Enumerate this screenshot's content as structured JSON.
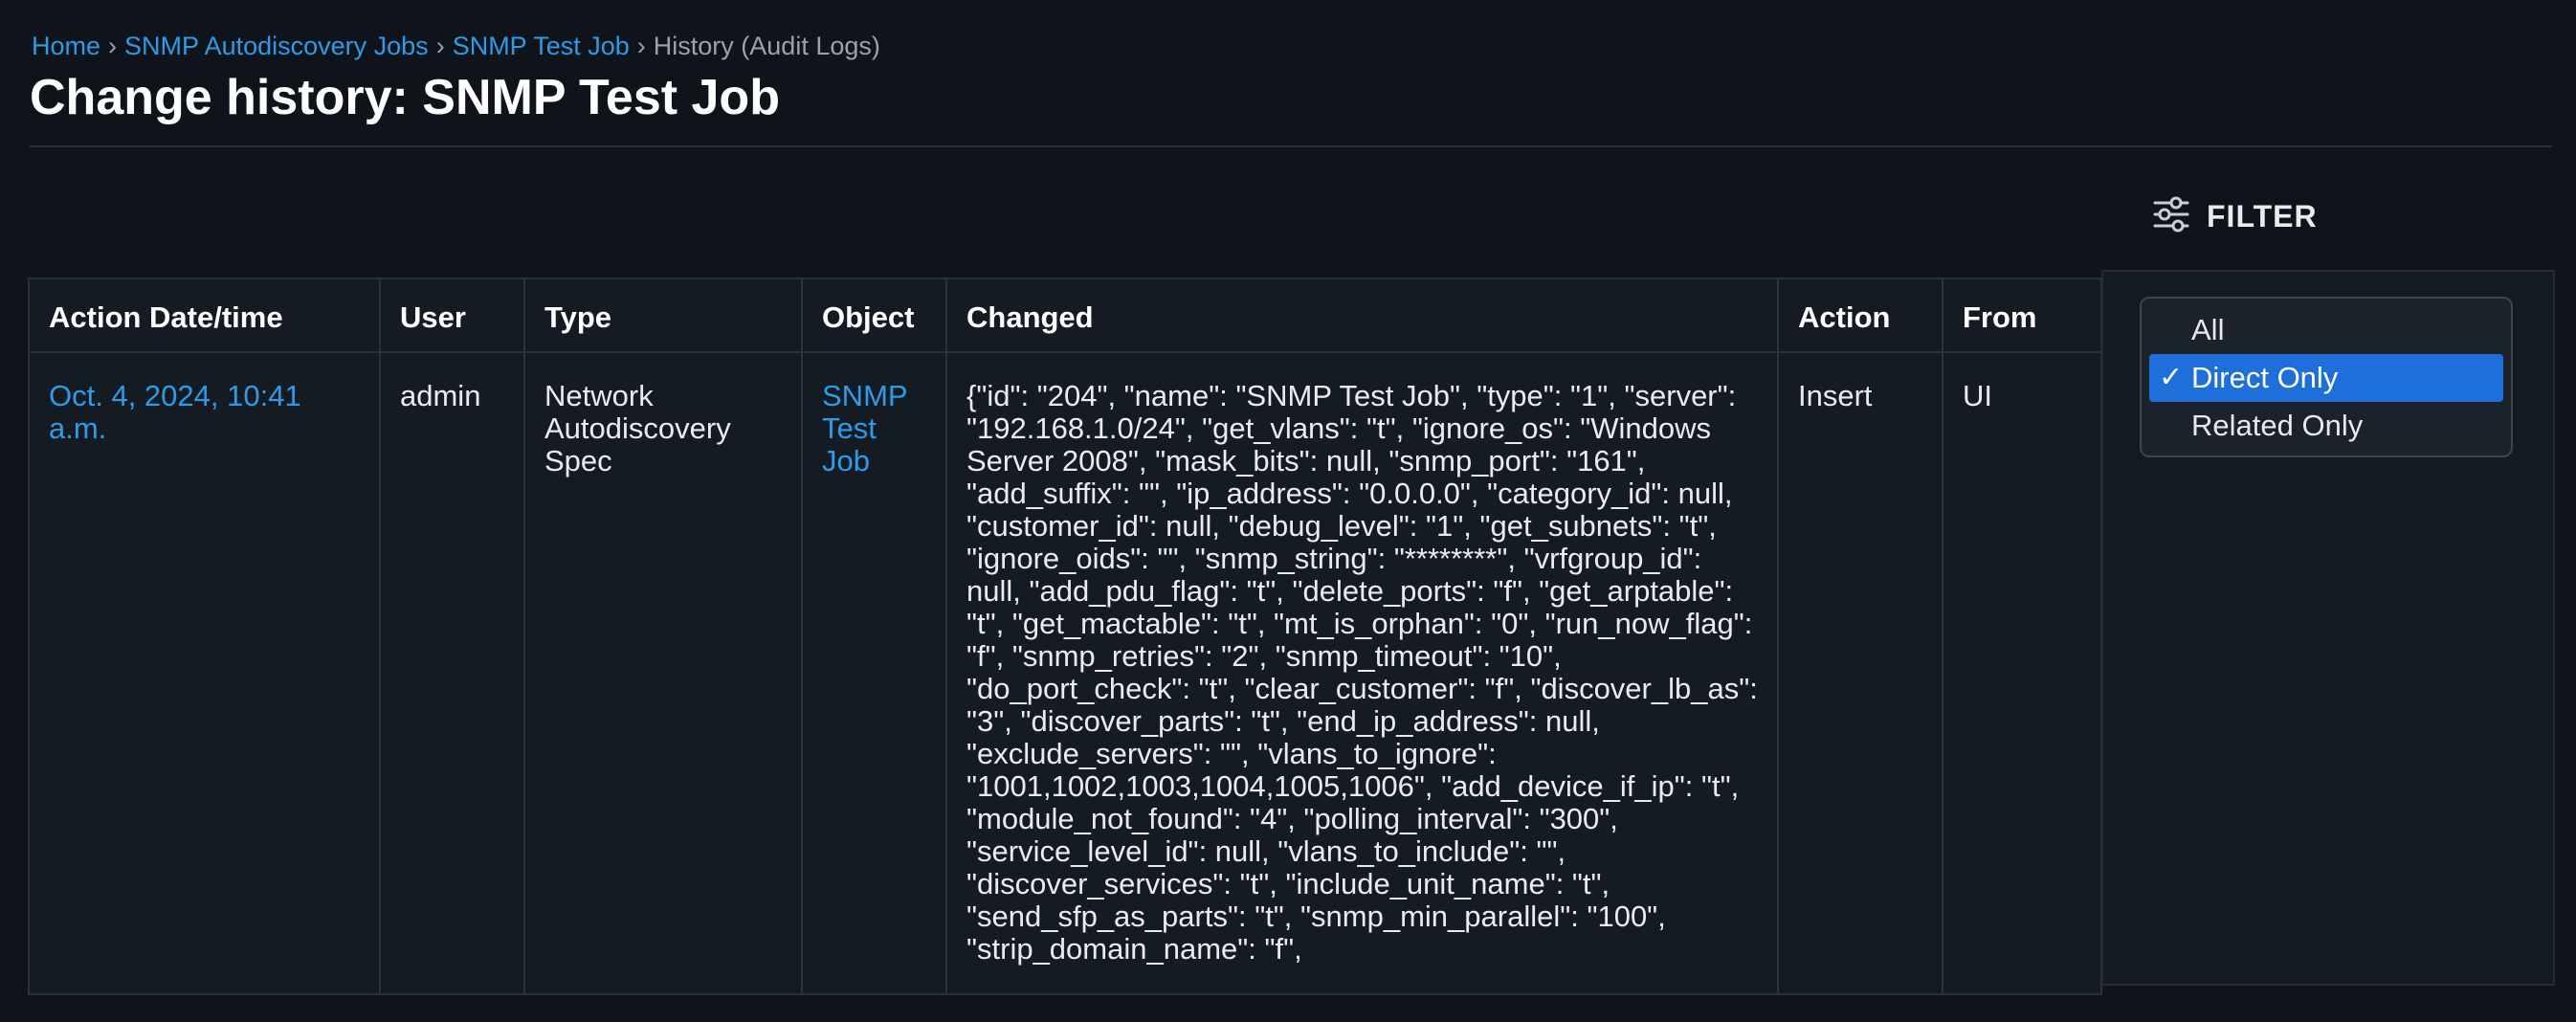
{
  "breadcrumb": {
    "items": [
      {
        "label": "Home"
      },
      {
        "label": "SNMP Autodiscovery Jobs"
      },
      {
        "label": "SNMP Test Job"
      }
    ],
    "separator": "›",
    "current": "History (Audit Logs)"
  },
  "page": {
    "title": "Change history: SNMP Test Job"
  },
  "filter": {
    "icon": "sliders-icon",
    "label": "FILTER",
    "options": [
      "All",
      "Direct Only",
      "Related Only"
    ],
    "selected": "Direct Only",
    "check": "✓"
  },
  "table": {
    "headers": [
      "Action Date/time",
      "User",
      "Type",
      "Object",
      "Changed",
      "Action",
      "From"
    ],
    "rows": [
      {
        "datetime": "Oct. 4, 2024, 10:41 a.m.",
        "user": "admin",
        "type": "Network Autodiscovery Spec",
        "object": "SNMP Test Job",
        "changed": "{\"id\": \"204\", \"name\": \"SNMP Test Job\", \"type\": \"1\", \"server\": \"192.168.1.0/24\", \"get_vlans\": \"t\", \"ignore_os\": \"Windows Server 2008\", \"mask_bits\": null, \"snmp_port\": \"161\", \"add_suffix\": \"\", \"ip_address\": \"0.0.0.0\", \"category_id\": null, \"customer_id\": null, \"debug_level\": \"1\", \"get_subnets\": \"t\", \"ignore_oids\": \"\", \"snmp_string\": \"********\", \"vrfgroup_id\": null, \"add_pdu_flag\": \"t\", \"delete_ports\": \"f\", \"get_arptable\": \"t\", \"get_mactable\": \"t\", \"mt_is_orphan\": \"0\", \"run_now_flag\": \"f\", \"snmp_retries\": \"2\", \"snmp_timeout\": \"10\", \"do_port_check\": \"t\", \"clear_customer\": \"f\", \"discover_lb_as\": \"3\", \"discover_parts\": \"t\", \"end_ip_address\": null, \"exclude_servers\": \"\", \"vlans_to_ignore\": \"1001,1002,1003,1004,1005,1006\", \"add_device_if_ip\": \"t\", \"module_not_found\": \"4\", \"polling_interval\": \"300\", \"service_level_id\": null, \"vlans_to_include\": \"\", \"discover_services\": \"t\", \"include_unit_name\": \"t\", \"send_sfp_as_parts\": \"t\", \"snmp_min_parallel\": \"100\", \"strip_domain_name\": \"f\",",
        "action": "Insert",
        "from": "UI"
      }
    ]
  }
}
